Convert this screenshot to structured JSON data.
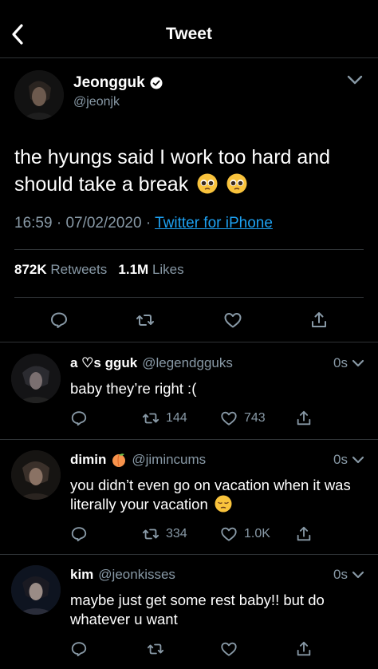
{
  "header": {
    "title": "Tweet"
  },
  "tweet": {
    "author_name": "Jeongguk",
    "author_handle": "@jeonjk",
    "text": "the hyungs said I work too hard and should take a break",
    "time": "16:59",
    "date": "07/02/2020",
    "source": "Twitter for iPhone",
    "retweets_count": "872K",
    "retweets_label": "Retweets",
    "likes_count": "1.1M",
    "likes_label": "Likes",
    "emojis": [
      "pleading-face",
      "pleading-face"
    ]
  },
  "replies": [
    {
      "name": "a ♡s gguk",
      "handle": "@legendgguks",
      "time": "0s",
      "text": "baby they’re right :(",
      "retweets": "144",
      "likes": "743"
    },
    {
      "name": "dimin",
      "name_emoji": "peach",
      "handle": "@jimincums",
      "time": "0s",
      "text": "you didn’t even go on vacation when it was literally your vacation",
      "text_emoji": "pensive-face",
      "retweets": "334",
      "likes": "1.0K"
    },
    {
      "name": "kim",
      "handle": "@jeonkisses",
      "time": "0s",
      "text": "maybe just get some rest baby!! but do whatever u want",
      "retweets": "",
      "likes": ""
    }
  ],
  "colors": {
    "background": "#000000",
    "secondary_text": "#8899a6",
    "link": "#1da1f2",
    "divider": "#2f3336"
  }
}
